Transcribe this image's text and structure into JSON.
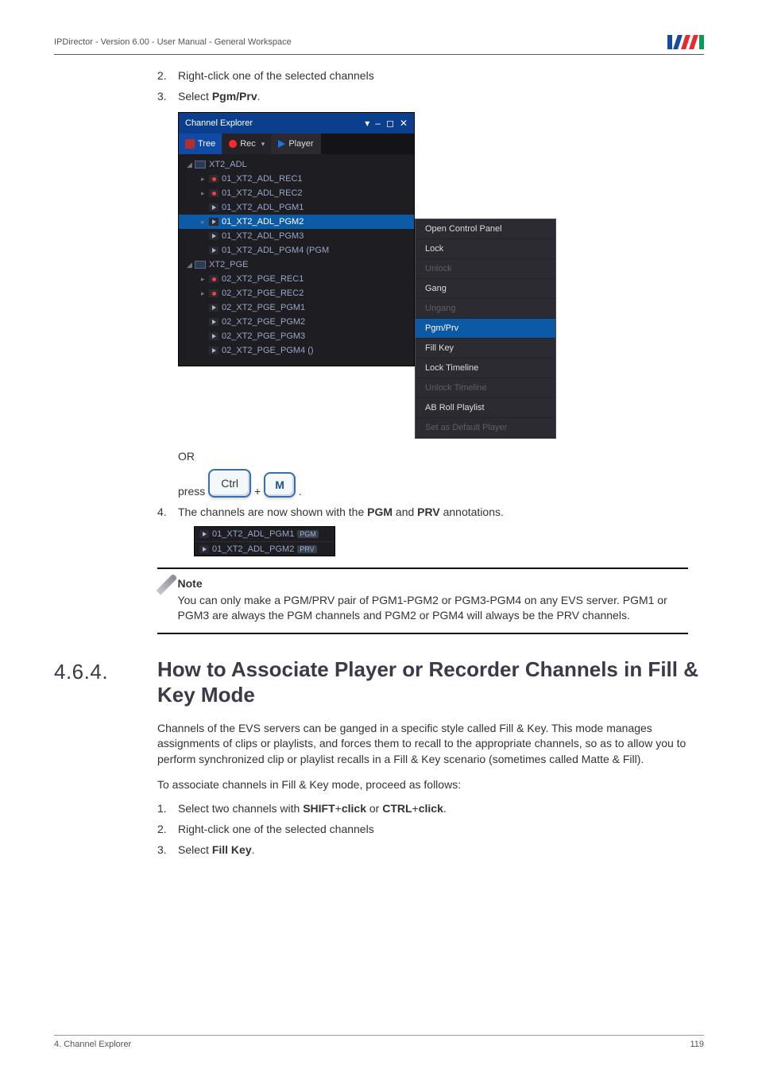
{
  "header": {
    "title": "IPDirector - Version 6.00 - User Manual - General Workspace"
  },
  "logo": {
    "bars": [
      "#1a4aa0",
      "#ffffff",
      "#e52b2b",
      "#ffffff",
      "#0a9b5c"
    ]
  },
  "steps_top": [
    {
      "num": "2.",
      "text_before": "Right-click one of the selected channels"
    },
    {
      "num": "3.",
      "text_before": "Select ",
      "bold": "Pgm/Prv",
      "text_after": "."
    }
  ],
  "explorer": {
    "title": "Channel Explorer",
    "window_controls": [
      "▾",
      "–",
      "◻",
      "✕"
    ],
    "toolbar": {
      "tree": "Tree",
      "rec": "Rec",
      "player": "Player"
    },
    "tree": [
      {
        "type": "xt",
        "label": "XT2_ADL",
        "level": 1,
        "arrow": "◢"
      },
      {
        "type": "rec",
        "label": "01_XT2_ADL_REC1",
        "level": 2,
        "arrow": "▸"
      },
      {
        "type": "rec",
        "label": "01_XT2_ADL_REC2",
        "level": 2,
        "arrow": "▸"
      },
      {
        "type": "play",
        "label": "01_XT2_ADL_PGM1",
        "level": 2,
        "arrow": ""
      },
      {
        "type": "play",
        "label": "01_XT2_ADL_PGM2",
        "level": 2,
        "arrow": "▸",
        "selected": true
      },
      {
        "type": "play",
        "label": "01_XT2_ADL_PGM3",
        "level": 2,
        "arrow": ""
      },
      {
        "type": "play",
        "label": "01_XT2_ADL_PGM4 (PGM",
        "level": 2,
        "arrow": ""
      },
      {
        "type": "xt",
        "label": "XT2_PGE",
        "level": 1,
        "arrow": "◢"
      },
      {
        "type": "rec",
        "label": "02_XT2_PGE_REC1",
        "level": 2,
        "arrow": "▸"
      },
      {
        "type": "rec",
        "label": "02_XT2_PGE_REC2",
        "level": 2,
        "arrow": "▸"
      },
      {
        "type": "play",
        "label": "02_XT2_PGE_PGM1",
        "level": 2,
        "arrow": ""
      },
      {
        "type": "play",
        "label": "02_XT2_PGE_PGM2",
        "level": 2,
        "arrow": ""
      },
      {
        "type": "play",
        "label": "02_XT2_PGE_PGM3",
        "level": 2,
        "arrow": ""
      },
      {
        "type": "play",
        "label": "02_XT2_PGE_PGM4 ()",
        "level": 2,
        "arrow": ""
      }
    ]
  },
  "context_menu": [
    {
      "label": "Open Control Panel",
      "state": "normal"
    },
    {
      "label": "Lock",
      "state": "normal"
    },
    {
      "label": "Unlock",
      "state": "disabled"
    },
    {
      "label": "Gang",
      "state": "normal"
    },
    {
      "label": "Ungang",
      "state": "disabled"
    },
    {
      "label": "Pgm/Prv",
      "state": "hi"
    },
    {
      "label": "Fill Key",
      "state": "normal"
    },
    {
      "label": "Lock Timeline",
      "state": "normal"
    },
    {
      "label": "Unlock Timeline",
      "state": "disabled"
    },
    {
      "label": "AB Roll Playlist",
      "state": "normal"
    },
    {
      "label": "Set as Default Player",
      "state": "disabled"
    }
  ],
  "or_block": {
    "or": "OR",
    "press": "press",
    "key1": "Ctrl",
    "plus": "+",
    "key2": "M",
    "dot": "."
  },
  "step4": {
    "num": "4.",
    "before": "The channels are now shown with the ",
    "b1": "PGM",
    "mid": " and ",
    "b2": "PRV",
    "after": " annotations."
  },
  "result_rows": [
    {
      "label": "01_XT2_ADL_PGM1",
      "badge": "PGM"
    },
    {
      "label": "01_XT2_ADL_PGM2",
      "badge": "PRV"
    }
  ],
  "note": {
    "title": "Note",
    "body": "You can only make a PGM/PRV pair of PGM1-PGM2 or PGM3-PGM4 on any EVS server. PGM1 or PGM3 are always the PGM channels and PGM2 or PGM4 will always be the PRV channels."
  },
  "section": {
    "num": "4.6.4.",
    "title": "How to Associate Player or Recorder Channels in Fill & Key Mode"
  },
  "body_paras": [
    "Channels of the EVS servers can be ganged in a specific style called Fill & Key. This mode manages assignments of clips or playlists, and forces them to recall to the appropriate channels, so as to allow you to perform synchronized clip or playlist recalls in a Fill & Key scenario (sometimes called Matte & Fill).",
    "To associate channels in Fill & Key mode, proceed as follows:"
  ],
  "steps_bottom": [
    {
      "num": "1.",
      "parts": [
        "Select two channels with ",
        "SHIFT",
        "+",
        "click",
        " or ",
        "CTRL",
        "+",
        "click",
        "."
      ]
    },
    {
      "num": "2.",
      "parts": [
        "Right-click one of the selected channels"
      ]
    },
    {
      "num": "3.",
      "parts": [
        "Select ",
        "Fill Key",
        "."
      ]
    }
  ],
  "footer": {
    "left": "4. Channel Explorer",
    "right": "119"
  }
}
